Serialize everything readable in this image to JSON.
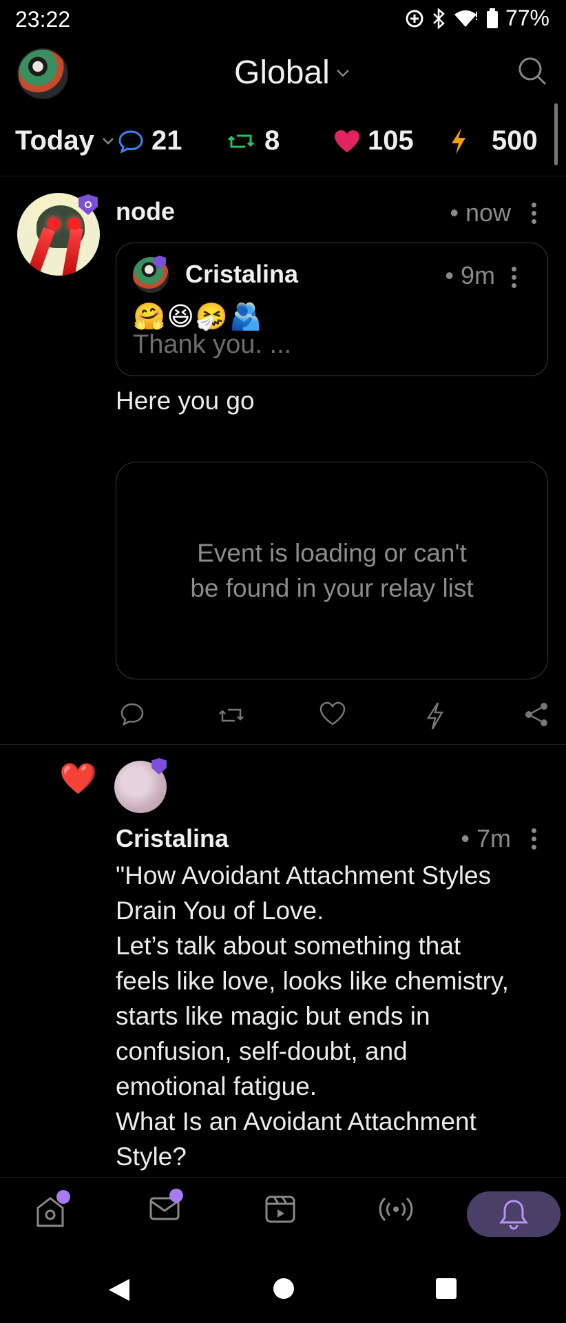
{
  "status_bar": {
    "time": "23:22",
    "battery": "77%"
  },
  "header": {
    "title": "Global"
  },
  "stats": {
    "period": "Today",
    "replies": "21",
    "reposts": "8",
    "likes": "105",
    "zaps": "500"
  },
  "colors": {
    "reply": "#3b82f6",
    "repost": "#22c55e",
    "like": "#e0245e",
    "zap": "#f59e0b",
    "accent": "#a87cf0"
  },
  "post1": {
    "author": "node",
    "time": "• now",
    "quote": {
      "author": "Cristalina",
      "time": "• 9m",
      "emojis": "🤗😆🤧🫂",
      "text": "Thank you. ..."
    },
    "body": "Here you go",
    "event_placeholder": "Event is loading or can't be found in your relay list"
  },
  "post2": {
    "reaction": "❤️",
    "author": "Cristalina",
    "time": "• 7m",
    "lines": [
      "\"How Avoidant Attachment Styles",
      "Drain You of Love.",
      "Let’s talk about something that",
      "feels like love, looks like chemistry,",
      "starts like magic but ends in",
      "confusion, self-doubt, and",
      "emotional fatigue.",
      "What Is an Avoidant Attachment",
      "Style?"
    ]
  },
  "bottom_nav": {
    "items": [
      "home-icon",
      "messages-icon",
      "video-icon",
      "relay-icon",
      "notifications-icon"
    ],
    "active": "notifications-icon"
  }
}
